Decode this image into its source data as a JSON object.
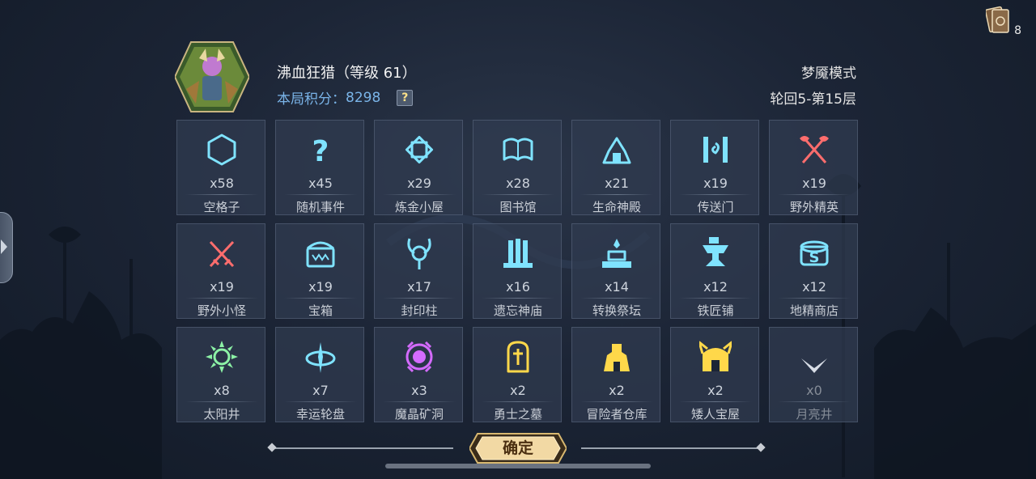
{
  "hud": {
    "card_icon": "card-deck-icon",
    "card_count": "8"
  },
  "hero": {
    "name": "沸血狂猎（等级 61）",
    "score_label": "本局积分：",
    "score_value": "8298",
    "help_label": "?"
  },
  "mode": {
    "title": "梦魇模式",
    "stage": "轮回5-第15层"
  },
  "tiles": [
    {
      "icon": "hexagon-icon",
      "count": "x58",
      "name": "空格子",
      "color": "#7fe3ff"
    },
    {
      "icon": "question-icon",
      "count": "x45",
      "name": "随机事件",
      "color": "#7fe3ff"
    },
    {
      "icon": "alchemy-diamond-icon",
      "count": "x29",
      "name": "炼金小屋",
      "color": "#7fe3ff"
    },
    {
      "icon": "open-book-icon",
      "count": "x28",
      "name": "图书馆",
      "color": "#7fe3ff"
    },
    {
      "icon": "temple-icon",
      "count": "x21",
      "name": "生命神殿",
      "color": "#7fe3ff"
    },
    {
      "icon": "portal-gate-icon",
      "count": "x19",
      "name": "传送门",
      "color": "#7fe3ff"
    },
    {
      "icon": "crossed-axes-icon",
      "count": "x19",
      "name": "野外精英",
      "color": "#ff6d6d"
    },
    {
      "icon": "crossed-swords-icon",
      "count": "x19",
      "name": "野外小怪",
      "color": "#ff6d6d"
    },
    {
      "icon": "treasure-chest-icon",
      "count": "x19",
      "name": "宝箱",
      "color": "#7fe3ff"
    },
    {
      "icon": "sealed-pillar-icon",
      "count": "x17",
      "name": "封印柱",
      "color": "#7fe3ff"
    },
    {
      "icon": "forgotten-temple-icon",
      "count": "x16",
      "name": "遗忘神庙",
      "color": "#7fe3ff"
    },
    {
      "icon": "altar-icon",
      "count": "x14",
      "name": "转换祭坛",
      "color": "#7fe3ff"
    },
    {
      "icon": "anvil-icon",
      "count": "x12",
      "name": "铁匠铺",
      "color": "#7fe3ff"
    },
    {
      "icon": "goblin-shop-icon",
      "count": "x12",
      "name": "地精商店",
      "color": "#7fe3ff"
    },
    {
      "icon": "sun-well-icon",
      "count": "x8",
      "name": "太阳井",
      "color": "#8cf2a6"
    },
    {
      "icon": "lucky-wheel-icon",
      "count": "x7",
      "name": "幸运轮盘",
      "color": "#7fe3ff"
    },
    {
      "icon": "crystal-mine-icon",
      "count": "x3",
      "name": "魔晶矿洞",
      "color": "#d46bff"
    },
    {
      "icon": "tomb-icon",
      "count": "x2",
      "name": "勇士之墓",
      "color": "#ffd84a"
    },
    {
      "icon": "warehouse-icon",
      "count": "x2",
      "name": "冒险者仓库",
      "color": "#ffd84a"
    },
    {
      "icon": "dwarf-house-icon",
      "count": "x2",
      "name": "矮人宝屋",
      "color": "#ffd84a"
    },
    {
      "icon": "moon-well-icon",
      "count": "x0",
      "name": "月亮井",
      "color": "#d8dde6",
      "dim": true
    }
  ],
  "confirm": {
    "label": "确定"
  }
}
